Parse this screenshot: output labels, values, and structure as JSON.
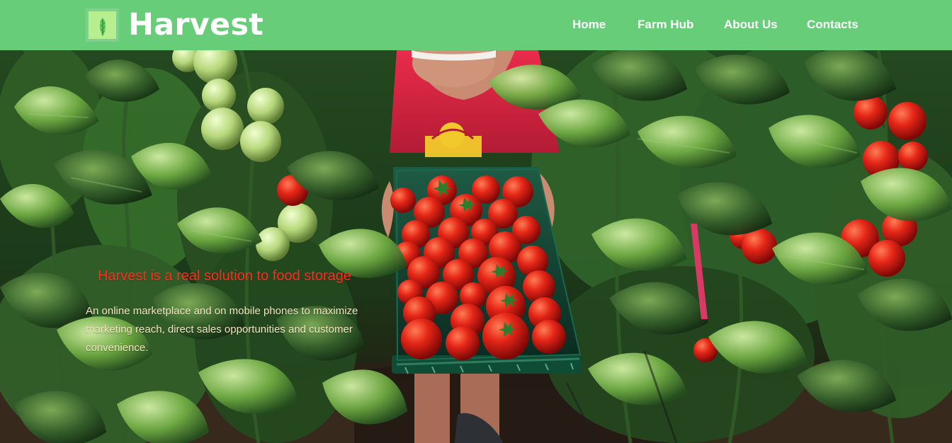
{
  "header": {
    "brand_name": "Harvest",
    "logo_icon": "leaf-logo-icon",
    "nav": [
      {
        "label": "Home"
      },
      {
        "label": "Farm Hub"
      },
      {
        "label": "About Us"
      },
      {
        "label": "Contacts"
      }
    ]
  },
  "hero": {
    "headline": "Harvest is a real solution to food storage",
    "body": "An online marketplace and on mobile phones to maximize marketing reach, direct sales opportunities and customer convenience."
  },
  "colors": {
    "header_bg": "#67cd78",
    "logo_bg": "#b7ee90",
    "headline_red": "#ff2c20",
    "body_text": "#f5e4c2"
  }
}
